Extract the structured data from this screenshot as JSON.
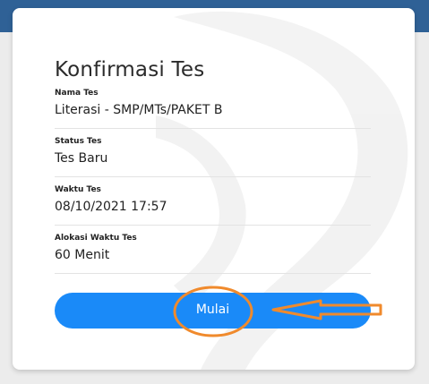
{
  "dialog": {
    "title": "Konfirmasi Tes",
    "fields": [
      {
        "label": "Nama Tes",
        "value": "Literasi - SMP/MTs/PAKET B"
      },
      {
        "label": "Status Tes",
        "value": "Tes Baru"
      },
      {
        "label": "Waktu Tes",
        "value": "08/10/2021 17:57"
      },
      {
        "label": "Alokasi Waktu Tes",
        "value": "60 Menit"
      }
    ],
    "start_button_label": "Mulai"
  },
  "colors": {
    "top_bar": "#2f6196",
    "button": "#1a8af8",
    "annotation": "#f08a2c"
  }
}
